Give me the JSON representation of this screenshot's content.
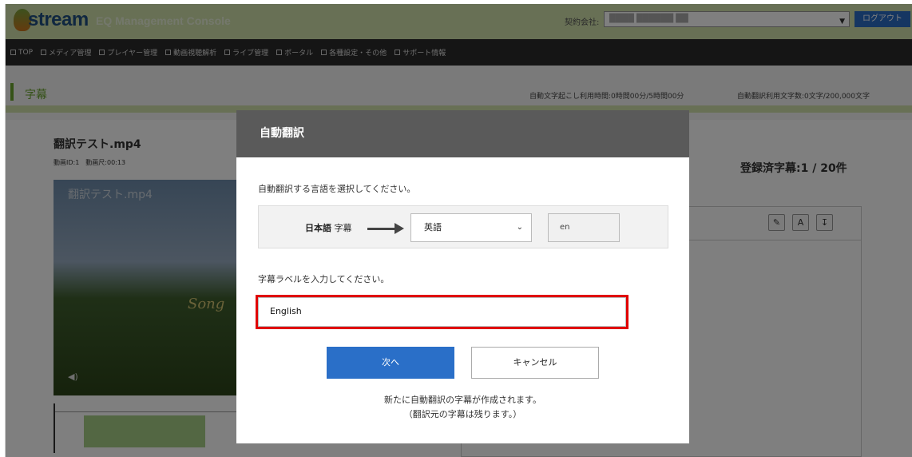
{
  "header": {
    "logo_text": "stream",
    "console_title": "EQ Management Console",
    "company_label": "契約会社:",
    "company_value": "████ ██████ ██",
    "logout_label": "ログアウト"
  },
  "nav": {
    "items": [
      "TOP",
      "メディア管理",
      "プレイヤー管理",
      "動画視聴解析",
      "ライブ管理",
      "ポータル",
      "各種設定・その他",
      "サポート情報"
    ]
  },
  "subheader": {
    "title": "字幕",
    "usage_transcription": "自動文字起こし利用時間:0時間00分/5時間00分",
    "usage_translation": "自動翻訳利用文字数:0文字/200,000文字"
  },
  "video": {
    "title": "翻訳テスト.mp4",
    "meta": "動画ID:1　動画尺:00:13",
    "overlay_caption": "翻訳テスト.mp4",
    "song_text": "Song"
  },
  "subtitles": {
    "registered": "登録済字幕:1 / 20件"
  },
  "modal": {
    "title": "自動翻訳",
    "select_instruction": "自動翻訳する言語を選択してください。",
    "source_lang": "日本語",
    "source_suffix": "字幕",
    "target_lang": "英語",
    "lang_code": "en",
    "label_instruction": "字幕ラベルを入力してください。",
    "label_value": "English",
    "next_label": "次へ",
    "cancel_label": "キャンセル",
    "note_line1": "新たに自動翻訳の字幕が作成されます。",
    "note_line2": "（翻訳元の字幕は残ります。）"
  },
  "colors": {
    "header_green": "#d0e1ab",
    "accent_green": "#6aa42f",
    "primary_blue": "#2a6fc8",
    "highlight_red": "#e00000"
  }
}
